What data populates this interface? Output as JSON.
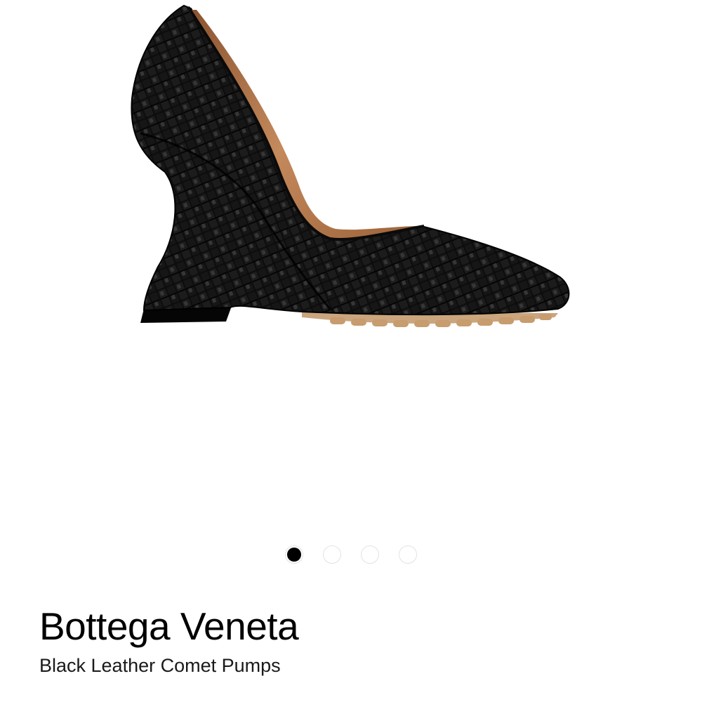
{
  "product": {
    "brand": "Bottega Veneta",
    "name": "Black Leather Comet Pumps",
    "image_alt_icon": "shoe-image",
    "colors": {
      "leather": "#111111",
      "lining": "#b3764a",
      "sole": "#c9a37a"
    }
  },
  "carousel": {
    "total": 4,
    "active_index": 0
  }
}
